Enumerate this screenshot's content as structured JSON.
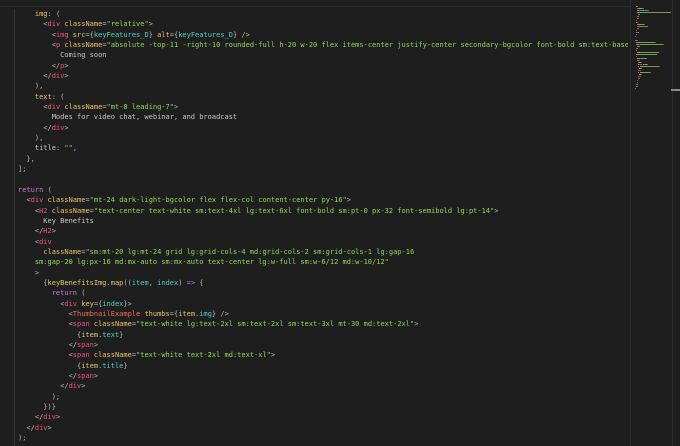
{
  "editor": {
    "lines": [
      [
        [
          "o",
          "    img"
        ],
        [
          "p",
          ": ("
        ]
      ],
      [
        [
          "p",
          "      <"
        ],
        [
          "t",
          "div"
        ],
        [
          "a",
          " className"
        ],
        [
          "p",
          "="
        ],
        [
          "s",
          "\"relative\""
        ],
        [
          "p",
          ">"
        ]
      ],
      [
        [
          "p",
          "        <"
        ],
        [
          "t",
          "img"
        ],
        [
          "a",
          " src"
        ],
        [
          "p",
          "={"
        ],
        [
          "v",
          "keyFeatures_D"
        ],
        [
          "p",
          "}"
        ],
        [
          "a",
          " alt"
        ],
        [
          "p",
          "={"
        ],
        [
          "v",
          "keyFeatures_D"
        ],
        [
          "p",
          "} />"
        ]
      ],
      [
        [
          "p",
          "        <"
        ],
        [
          "t",
          "p"
        ],
        [
          "a",
          " className"
        ],
        [
          "p",
          "="
        ],
        [
          "s",
          "\"absolute -top-11 -right-10 rounded-full h-20 w-20 flex items-center justify-center secondary-bgcolor font-bold sm:text-base"
        ]
      ],
      [
        [
          "x",
          "          Coming soon"
        ]
      ],
      [
        [
          "p",
          "        </"
        ],
        [
          "t",
          "p"
        ],
        [
          "p",
          ">"
        ]
      ],
      [
        [
          "p",
          "      </"
        ],
        [
          "t",
          "div"
        ],
        [
          "p",
          ">"
        ]
      ],
      [
        [
          "p",
          "    ),"
        ]
      ],
      [
        [
          "o",
          "    text"
        ],
        [
          "p",
          ": ("
        ]
      ],
      [
        [
          "p",
          "      <"
        ],
        [
          "t",
          "div"
        ],
        [
          "a",
          " className"
        ],
        [
          "p",
          "="
        ],
        [
          "s",
          "\"mt-8 leading-7\""
        ],
        [
          "p",
          ">"
        ]
      ],
      [
        [
          "x",
          "        Modes for video chat, webinar, and broadcast"
        ]
      ],
      [
        [
          "p",
          "      </"
        ],
        [
          "t",
          "div"
        ],
        [
          "p",
          ">"
        ]
      ],
      [
        [
          "p",
          "    ),"
        ]
      ],
      [
        [
          "x",
          "    title"
        ],
        [
          "p",
          ": "
        ],
        [
          "s",
          "\"\""
        ],
        [
          "p",
          ","
        ]
      ],
      [
        [
          "p",
          "  },"
        ]
      ],
      [
        [
          "p",
          "];"
        ]
      ],
      [
        [
          "x",
          " "
        ]
      ],
      [
        [
          "k",
          "return"
        ],
        [
          "p",
          " ("
        ]
      ],
      [
        [
          "p",
          "  <"
        ],
        [
          "t",
          "div"
        ],
        [
          "a",
          " className"
        ],
        [
          "p",
          "="
        ],
        [
          "s",
          "\"mt-24 dark-light-bgcolor flex flex-col content-center py-16\""
        ],
        [
          "p",
          ">"
        ]
      ],
      [
        [
          "p",
          "    <"
        ],
        [
          "t",
          "H2"
        ],
        [
          "a",
          " className"
        ],
        [
          "p",
          "="
        ],
        [
          "s",
          "\"text-center text-white sm:text-4xl lg:text-6xl font-bold sm:pt-0 px-32 font-semibold lg:pt-14\""
        ],
        [
          "p",
          ">"
        ]
      ],
      [
        [
          "x",
          "      Key Benefits"
        ]
      ],
      [
        [
          "p",
          "    </"
        ],
        [
          "t",
          "H2"
        ],
        [
          "p",
          ">"
        ]
      ],
      [
        [
          "p",
          "    <"
        ],
        [
          "t",
          "div"
        ]
      ],
      [
        [
          "a",
          "      className"
        ],
        [
          "p",
          "="
        ],
        [
          "s",
          "\"sm:mt-20 lg:mt-24 grid lg:grid-cols-4 md:grid-cols-2 sm:grid-cols-1 lg:gap-16"
        ]
      ],
      [
        [
          "s",
          "    sm:gap-20 lg:px-16 md:mx-auto sm:mx-auto text-center lg:w-full sm:w-6/12 md:w-10/12\""
        ]
      ],
      [
        [
          "p",
          "    >"
        ]
      ],
      [
        [
          "p",
          "      {"
        ],
        [
          "f",
          "keyBenefitsImg"
        ],
        [
          "p",
          "."
        ],
        [
          "f",
          "map"
        ],
        [
          "p",
          "(("
        ],
        [
          "v",
          "item"
        ],
        [
          "p",
          ", "
        ],
        [
          "v",
          "index"
        ],
        [
          "p",
          ") "
        ],
        [
          "k",
          "=>"
        ],
        [
          "p",
          " {"
        ]
      ],
      [
        [
          "k",
          "        return"
        ],
        [
          "p",
          " ("
        ]
      ],
      [
        [
          "p",
          "          <"
        ],
        [
          "t",
          "div"
        ],
        [
          "a",
          " key"
        ],
        [
          "p",
          "={"
        ],
        [
          "v",
          "index"
        ],
        [
          "p",
          "}>"
        ]
      ],
      [
        [
          "p",
          "            <"
        ],
        [
          "c",
          "ThumbnailExample"
        ],
        [
          "a",
          " thumbs"
        ],
        [
          "p",
          "={"
        ],
        [
          "f",
          "item"
        ],
        [
          "p",
          "."
        ],
        [
          "v",
          "img"
        ],
        [
          "p",
          "} />"
        ]
      ],
      [
        [
          "p",
          "            <"
        ],
        [
          "t",
          "span"
        ],
        [
          "a",
          " className"
        ],
        [
          "p",
          "="
        ],
        [
          "s",
          "\"text-white lg:text-2xl sm:text-2xl sm:text-3xl mt-30 md:text-2xl\""
        ],
        [
          "p",
          ">"
        ]
      ],
      [
        [
          "p",
          "              {"
        ],
        [
          "f",
          "item"
        ],
        [
          "p",
          "."
        ],
        [
          "v",
          "text"
        ],
        [
          "p",
          "}"
        ]
      ],
      [
        [
          "p",
          "            </"
        ],
        [
          "t",
          "span"
        ],
        [
          "p",
          ">"
        ]
      ],
      [
        [
          "p",
          "            <"
        ],
        [
          "t",
          "span"
        ],
        [
          "a",
          " className"
        ],
        [
          "p",
          "="
        ],
        [
          "s",
          "\"text-white text-2xl md:text-xl\""
        ],
        [
          "p",
          ">"
        ]
      ],
      [
        [
          "p",
          "              {"
        ],
        [
          "f",
          "item"
        ],
        [
          "p",
          "."
        ],
        [
          "v",
          "title"
        ],
        [
          "p",
          "}"
        ]
      ],
      [
        [
          "p",
          "            </"
        ],
        [
          "t",
          "span"
        ],
        [
          "p",
          ">"
        ]
      ],
      [
        [
          "p",
          "          </"
        ],
        [
          "t",
          "div"
        ],
        [
          "p",
          ">"
        ]
      ],
      [
        [
          "p",
          "        );"
        ]
      ],
      [
        [
          "p",
          "      })}"
        ]
      ],
      [
        [
          "p",
          "    </"
        ],
        [
          "t",
          "div"
        ],
        [
          "p",
          ">"
        ]
      ],
      [
        [
          "p",
          "  </"
        ],
        [
          "t",
          "div"
        ],
        [
          "p",
          ">"
        ]
      ],
      [
        [
          "p",
          ");"
        ]
      ]
    ]
  }
}
